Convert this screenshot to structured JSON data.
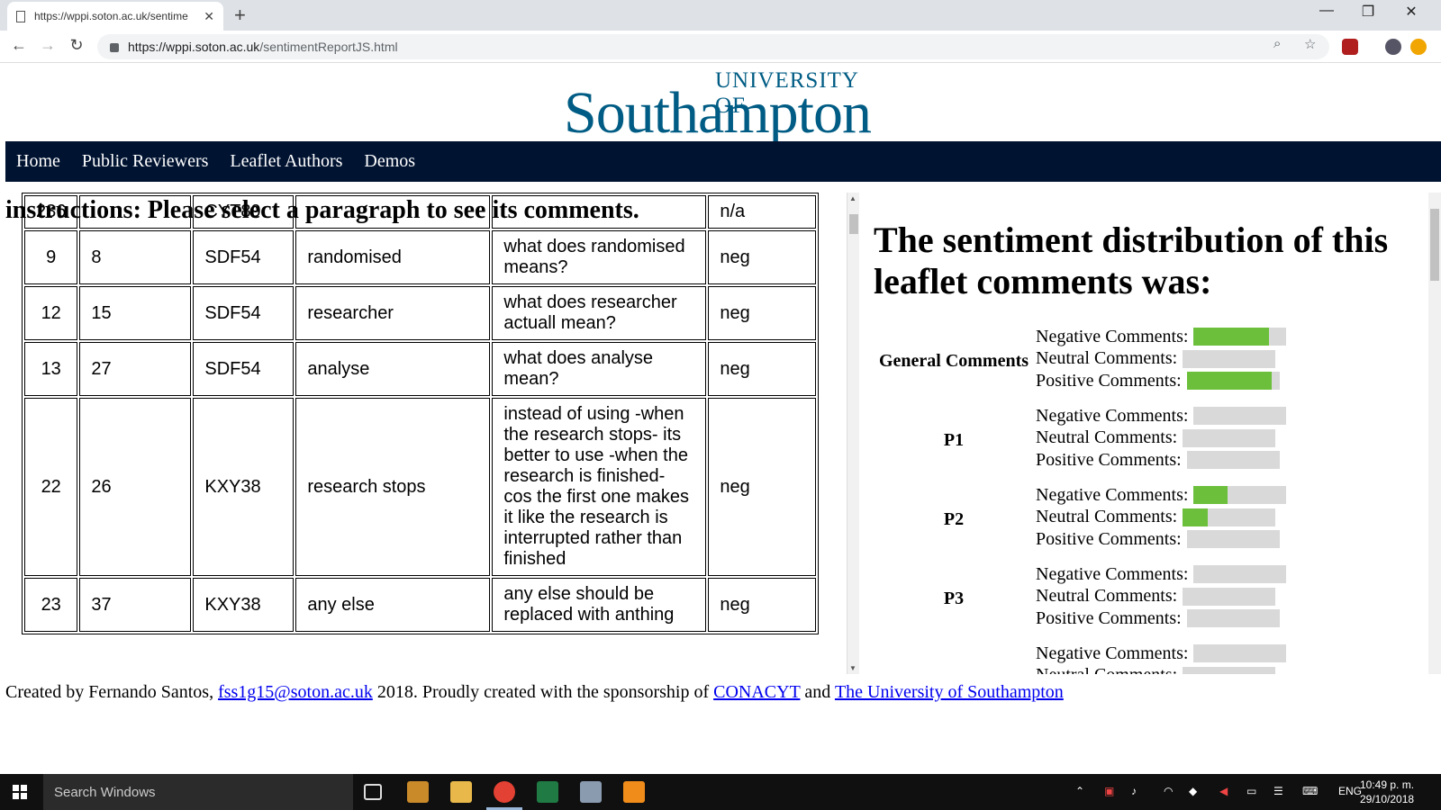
{
  "browser": {
    "tab_title": "https://wppi.soton.ac.uk/sentime",
    "tab_close": "✕",
    "new_tab": "+",
    "window_controls": {
      "minimize": "—",
      "maximize": "❐",
      "close": "✕"
    },
    "nav": {
      "back": "←",
      "forward": "→",
      "reload": "↻"
    },
    "url_host": "https://wppi.soton.ac.uk",
    "url_path": "/sentimentReportJS.html",
    "zoom_icon": "⌕",
    "star_icon": "☆"
  },
  "logo": {
    "line1": "UNIVERSITY OF",
    "line2": "Southampton"
  },
  "navbar": {
    "items": [
      "Home",
      "Public Reviewers",
      "Leaflet Authors",
      "Demos"
    ]
  },
  "instructions": "instructions: Please select a paragraph to see its comments.",
  "table": {
    "rows": [
      [
        "236",
        "",
        "CYT89",
        "",
        "",
        "n/a"
      ],
      [
        "9",
        "8",
        "SDF54",
        "randomised",
        "what does randomised means?",
        "neg"
      ],
      [
        "12",
        "15",
        "SDF54",
        "researcher",
        "what does researcher actuall mean?",
        "neg"
      ],
      [
        "13",
        "27",
        "SDF54",
        "analyse",
        "what does analyse mean?",
        "neg"
      ],
      [
        "22",
        "26",
        "KXY38",
        "research stops",
        "instead of using -when the research stops- its better to use -when the research is finished- cos the first one makes it like the research is interrupted rather than finished",
        "neg"
      ],
      [
        "23",
        "37",
        "KXY38",
        "any else",
        "any else should be replaced with anthing",
        "neg"
      ]
    ]
  },
  "sentiment": {
    "heading": "The sentiment distribution of this leaflet comments was:",
    "labels": {
      "neg": "Negative Comments:",
      "neu": "Neutral Comments:",
      "pos": "Positive Comments:"
    },
    "groups": [
      {
        "name": "General Comments",
        "neg": 0.88,
        "neu": 0.0,
        "pos": 1.0
      },
      {
        "name": "P1",
        "neg": 0.0,
        "neu": 0.0,
        "pos": 0.0
      },
      {
        "name": "P2",
        "neg": 0.4,
        "neu": 0.29,
        "pos": 0.0
      },
      {
        "name": "P3",
        "neg": 0.0,
        "neu": 0.0,
        "pos": 0.0
      },
      {
        "name": "",
        "neg": 0.0,
        "neu": 0.0,
        "pos": 0.0
      }
    ],
    "colors": {
      "fill": "#6cbf3a",
      "track": "#d9d9d9"
    }
  },
  "footer": {
    "prefix": "Created by Fernando Santos,",
    "email": "fss1g15@soton.ac.uk",
    "middle": "2018. Proudly created with the sponsorship of",
    "link1": "CONACYT",
    "and": "and",
    "link2": "The University of Southampton"
  },
  "taskbar": {
    "search_placeholder": "Search Windows",
    "lang": "ENG",
    "time": "10:49 p. m.",
    "date": "29/10/2018"
  }
}
